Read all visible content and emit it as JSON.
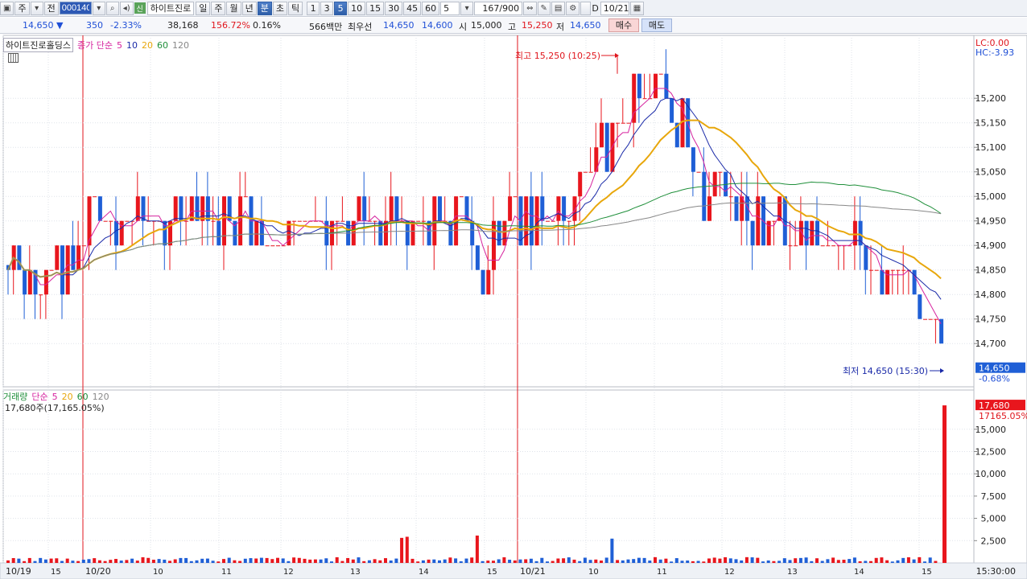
{
  "toolbar": {
    "market_mode": "주",
    "prev_label": "전",
    "stock_code": "000140",
    "sin_badge": "신",
    "stock_name": "하이트진로",
    "periods": [
      "일",
      "주",
      "월",
      "년",
      "분",
      "초",
      "틱"
    ],
    "active_period": "분",
    "intervals": [
      "1",
      "3",
      "5",
      "10",
      "15",
      "30",
      "45",
      "60"
    ],
    "active_interval": "5",
    "interval_select": "5",
    "count_display": "167/900",
    "date_checkbox_label": "D",
    "date_value": "10/21"
  },
  "quote": {
    "price": "14,650",
    "change": "350",
    "change_pct": "-2.33%",
    "volume": "38,168",
    "volume_ratio": "156.72%",
    "turnover_pct": "0.16%",
    "amount": "566백만",
    "priority_label": "최우선",
    "ask": "14,650",
    "bid": "14,600",
    "open_label": "시",
    "open": "15,000",
    "high_label": "고",
    "high": "15,250",
    "low_label": "저",
    "low": "14,650",
    "buy_label": "매수",
    "sell_label": "매도"
  },
  "price_pane": {
    "stock_tag": "하이트진로홀딩스",
    "ma_label": "종가 단순",
    "ma_periods": [
      "5",
      "10",
      "20",
      "60",
      "120"
    ],
    "ma_colors": [
      "#d6249f",
      "#1a2aa8",
      "#e8a70c",
      "#1f8f3a",
      "#888888"
    ],
    "lc_label": "LC:0.00",
    "hc_label": "HC:-3.93",
    "high_annotation": "최고 15,250 (10:25)",
    "low_annotation": "최저 14,650 (15:30)",
    "current_price_tag": "14,650",
    "current_pct_tag": "-0.68%"
  },
  "volume_pane": {
    "title": "거래량",
    "ma_label": "단순",
    "ma_periods": [
      "5",
      "20",
      "60",
      "120"
    ],
    "info": "17,680주(17,165.05%)",
    "last_volume_tag": "17,680",
    "last_pct_tag": "17165.05%"
  },
  "x_axis": {
    "labels": [
      "10/19",
      "15",
      "10/20",
      "10",
      "11",
      "12",
      "13",
      "14",
      "15",
      "10/21",
      "10",
      "11",
      "12",
      "13",
      "14",
      "15"
    ],
    "time_readout": "15:30:00"
  },
  "chart_data": {
    "type": "candlestick",
    "price_axis": {
      "ticks": [
        14700,
        14750,
        14800,
        14850,
        14900,
        14950,
        15000,
        15050,
        15100,
        15150,
        15200
      ],
      "ylim": [
        14620,
        15320
      ]
    },
    "volume_axis": {
      "ticks": [
        2500,
        5000,
        7500,
        10000,
        12500,
        15000
      ],
      "ylim": [
        0,
        18500
      ]
    },
    "x_labels": [
      "10/19",
      "15",
      "10/20",
      "10",
      "11",
      "12",
      "13",
      "14",
      "15",
      "10/21",
      "10",
      "11",
      "12",
      "13",
      "14",
      "15"
    ],
    "day_separators": [
      "10/20",
      "10/21"
    ],
    "summary": {
      "high": 15250,
      "high_time": "10:25",
      "low": 14650,
      "low_time": "15:30",
      "last": 14650,
      "last_volume": 17680
    },
    "ma_periods": [
      5,
      10,
      20,
      60,
      120
    ],
    "grid": true
  }
}
